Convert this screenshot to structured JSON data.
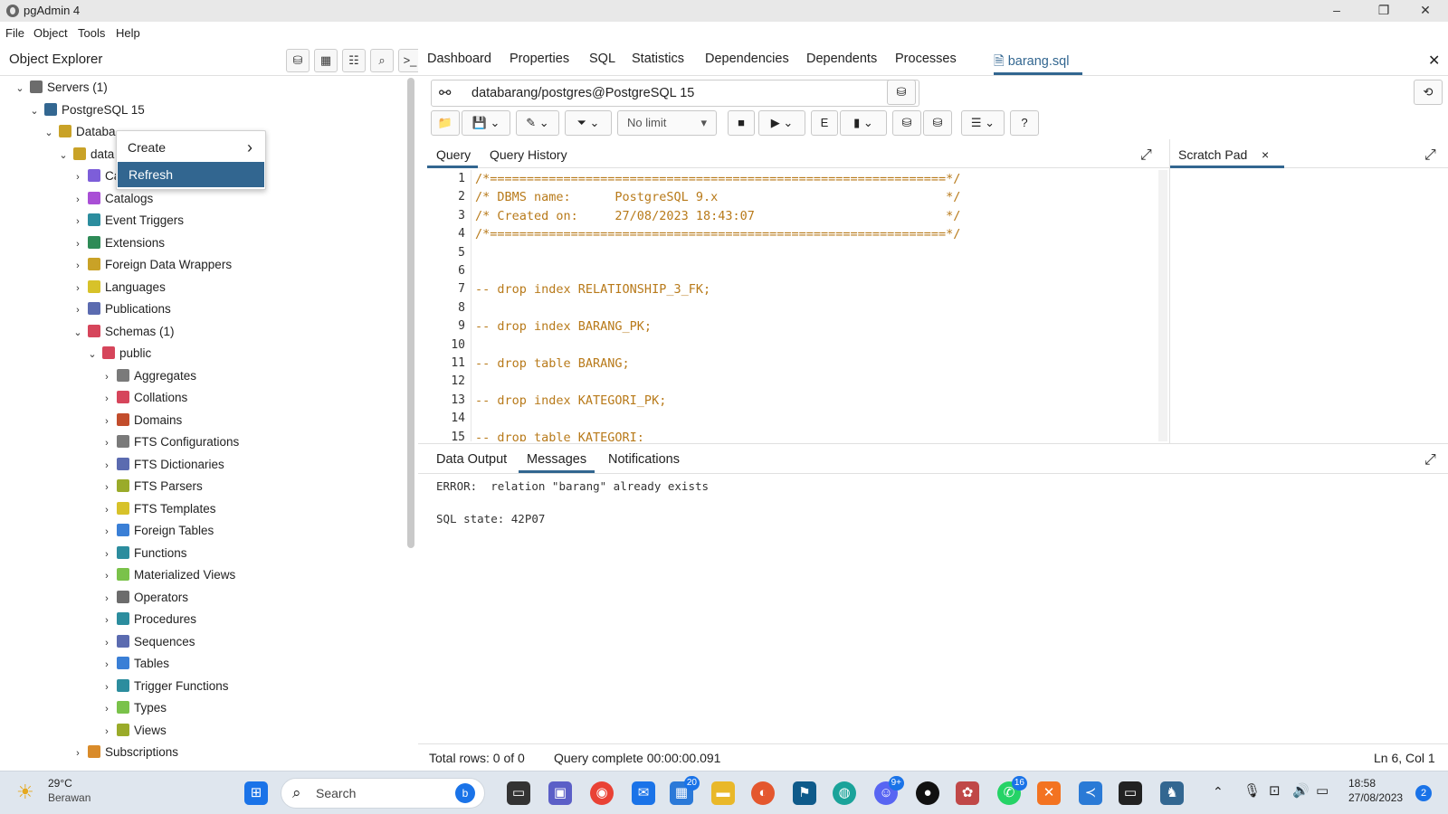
{
  "window": {
    "title": "pgAdmin 4",
    "min": "–",
    "max": "❐",
    "close": "✕"
  },
  "menu": [
    "File",
    "Object",
    "Tools",
    "Help"
  ],
  "explorer": {
    "title": "Object Explorer",
    "tree": [
      {
        "label": "Servers (1)",
        "chev": "⌄",
        "color": "#6c6c6c"
      },
      {
        "label": "PostgreSQL 15",
        "chev": "⌄",
        "color": "#336791"
      },
      {
        "label": "Databa",
        "chev": "⌄",
        "color": "#c9a227"
      },
      {
        "label": "data",
        "chev": "⌄",
        "color": "#c9a227"
      },
      {
        "label": "Ca",
        "chev": "›",
        "color": "#7d5ed9"
      },
      {
        "label": "Catalogs",
        "chev": "›",
        "color": "#a94fd6"
      },
      {
        "label": "Event Triggers",
        "chev": "›",
        "color": "#2c8d9e"
      },
      {
        "label": "Extensions",
        "chev": "›",
        "color": "#2e8b57"
      },
      {
        "label": "Foreign Data Wrappers",
        "chev": "›",
        "color": "#c9a227"
      },
      {
        "label": "Languages",
        "chev": "›",
        "color": "#d7c22a"
      },
      {
        "label": "Publications",
        "chev": "›",
        "color": "#5b6bb0"
      },
      {
        "label": "Schemas (1)",
        "chev": "⌄",
        "color": "#d6455b"
      },
      {
        "label": "public",
        "chev": "⌄",
        "color": "#d6455b"
      },
      {
        "label": "Aggregates",
        "chev": "›",
        "color": "#7a7a7a"
      },
      {
        "label": "Collations",
        "chev": "›",
        "color": "#d6455b"
      },
      {
        "label": "Domains",
        "chev": "›",
        "color": "#c24d2c"
      },
      {
        "label": "FTS Configurations",
        "chev": "›",
        "color": "#7a7a7a"
      },
      {
        "label": "FTS Dictionaries",
        "chev": "›",
        "color": "#5b6bb0"
      },
      {
        "label": "FTS Parsers",
        "chev": "›",
        "color": "#9aab2a"
      },
      {
        "label": "FTS Templates",
        "chev": "›",
        "color": "#d7c22a"
      },
      {
        "label": "Foreign Tables",
        "chev": "›",
        "color": "#3a7fd6"
      },
      {
        "label": "Functions",
        "chev": "›",
        "color": "#2c8d9e"
      },
      {
        "label": "Materialized Views",
        "chev": "›",
        "color": "#7ac24a"
      },
      {
        "label": "Operators",
        "chev": "›",
        "color": "#6c6c6c"
      },
      {
        "label": "Procedures",
        "chev": "›",
        "color": "#2c8d9e"
      },
      {
        "label": "Sequences",
        "chev": "›",
        "color": "#5b6bb0"
      },
      {
        "label": "Tables",
        "chev": "›",
        "color": "#3a7fd6"
      },
      {
        "label": "Trigger Functions",
        "chev": "›",
        "color": "#2c8d9e"
      },
      {
        "label": "Types",
        "chev": "›",
        "color": "#7ac24a"
      },
      {
        "label": "Views",
        "chev": "›",
        "color": "#9aab2a"
      },
      {
        "label": "Subscriptions",
        "chev": "›",
        "color": "#d98b2a"
      }
    ]
  },
  "context_menu": {
    "create": "Create",
    "create_arrow": "›",
    "refresh": "Refresh"
  },
  "tabs": [
    "Dashboard",
    "Properties",
    "SQL",
    "Statistics",
    "Dependencies",
    "Dependents",
    "Processes",
    "barang.sql"
  ],
  "connection": "databarang/postgres@PostgreSQL 15",
  "toolbar": {
    "limit": "No limit"
  },
  "query_tabs": {
    "query": "Query",
    "history": "Query History",
    "scratch": "Scratch Pad",
    "scratch_close": "×"
  },
  "code": [
    "/*==============================================================*/",
    "/* DBMS name:      PostgreSQL 9.x                               */",
    "/* Created on:     27/08/2023 18:43:07                          */",
    "/*==============================================================*/",
    "",
    "",
    "-- drop index RELATIONSHIP_3_FK;",
    "",
    "-- drop index BARANG_PK;",
    "",
    "-- drop table BARANG;",
    "",
    "-- drop index KATEGORI_PK;",
    "",
    "-- drop table KATEGORI;"
  ],
  "output_tabs": [
    "Data Output",
    "Messages",
    "Notifications"
  ],
  "messages": {
    "error": "ERROR:  relation \"barang\" already exists",
    "state": "SQL state: 42P07"
  },
  "status": {
    "rows": "Total rows: 0 of 0",
    "query": "Query complete 00:00:00.091",
    "pos": "Ln 6, Col 1"
  },
  "taskbar": {
    "temp": "29°C",
    "weather": "Berawan",
    "search": "Search",
    "time": "18:58",
    "date": "27/08/2023",
    "badge_mail": "20",
    "badge_wa": "16",
    "badge_discord": "9+",
    "notif": "2"
  }
}
